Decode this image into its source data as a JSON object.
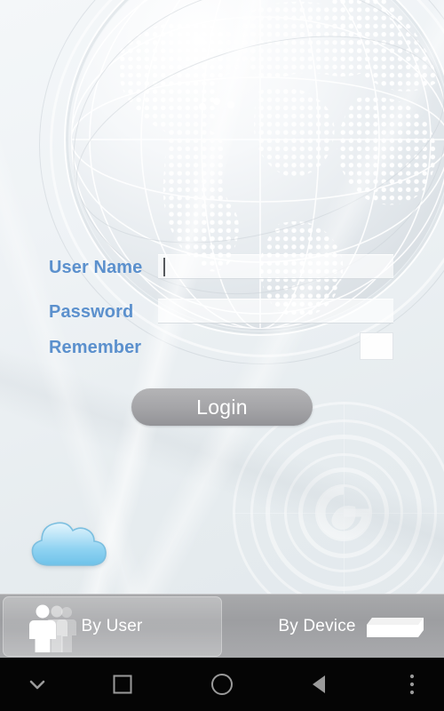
{
  "app": {
    "title": "Login",
    "background_graphics": {
      "globe_icon": "dotted-globe-graphic",
      "radar_icon": "concentric-radar-graphic",
      "center_logo_icon": "leaf-g-logo-icon",
      "cloud_icon": "cloud-icon"
    },
    "colors": {
      "label_blue": "#5b90cd",
      "button_gray": "#a6a6a9",
      "tabbar_gray": "#9d9ea1",
      "cloud_blue": "#7cc8ee",
      "navbar_black": "#050505"
    }
  },
  "form": {
    "username": {
      "label": "User Name",
      "value": "",
      "placeholder": ""
    },
    "password": {
      "label": "Password",
      "value": "",
      "placeholder": ""
    },
    "remember": {
      "label": "Remember",
      "checked": false
    },
    "login_button": "Login"
  },
  "tabbar": {
    "selected": "By User",
    "tabs": [
      {
        "label": "By User",
        "icon": "people-icon",
        "selected": true
      },
      {
        "label": "By Device",
        "icon": "device-box-icon",
        "selected": false
      }
    ]
  },
  "navbar": {
    "buttons": [
      {
        "name": "hide-keyboard",
        "icon": "chevron-down-icon"
      },
      {
        "name": "recents",
        "icon": "square-icon"
      },
      {
        "name": "home",
        "icon": "circle-icon"
      },
      {
        "name": "back",
        "icon": "triangle-left-icon"
      },
      {
        "name": "menu",
        "icon": "three-dots-icon"
      }
    ]
  }
}
